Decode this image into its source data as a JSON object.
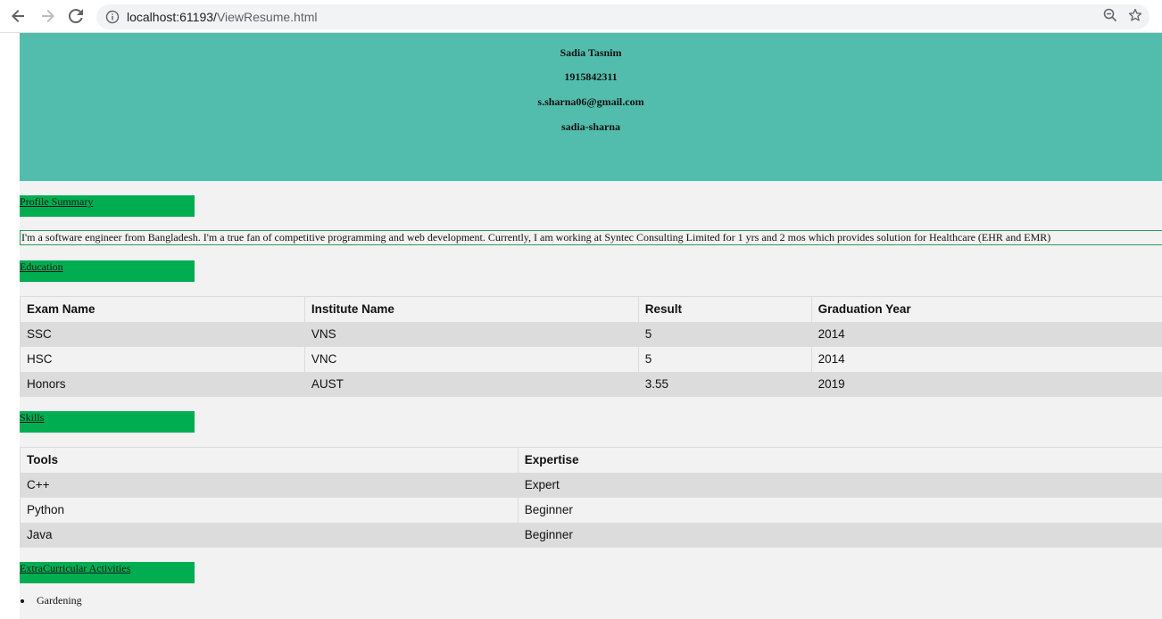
{
  "browser": {
    "url_host": "localhost:61193/",
    "url_path": "ViewResume.html"
  },
  "header": {
    "name": "Sadia Tasnim",
    "phone": "1915842311",
    "email": "s.sharna06@gmail.com",
    "handle": "sadia-sharna"
  },
  "sections": {
    "profile_summary": "Profile Summary",
    "education": "Education",
    "skills": "Skills",
    "extracurricular": "ExtraCurricular Activities"
  },
  "summary_text": "I'm a software engineer from Bangladesh. I'm a true fan of competitive programming and web development. Currently, I am working at Syntec Consulting Limited for 1 yrs and 2 mos which provides solution for Healthcare (EHR and EMR)",
  "education": {
    "headers": [
      "Exam Name",
      "Institute Name",
      "Result",
      "Graduation Year"
    ],
    "rows": [
      [
        "SSC",
        "VNS",
        "5",
        "2014"
      ],
      [
        "HSC",
        "VNC",
        "5",
        "2014"
      ],
      [
        "Honors",
        "AUST",
        "3.55",
        "2019"
      ]
    ]
  },
  "skills": {
    "headers": [
      "Tools",
      "Expertise"
    ],
    "rows": [
      [
        "C++",
        "Expert"
      ],
      [
        "Python",
        "Beginner"
      ],
      [
        "Java",
        "Beginner"
      ]
    ]
  },
  "activities": [
    "Gardening"
  ],
  "colors": {
    "header_bg": "#52bdad",
    "section_tag": "#00ad51",
    "row_stripe": "#dddcdd",
    "page_bg": "#f2f2f3"
  }
}
